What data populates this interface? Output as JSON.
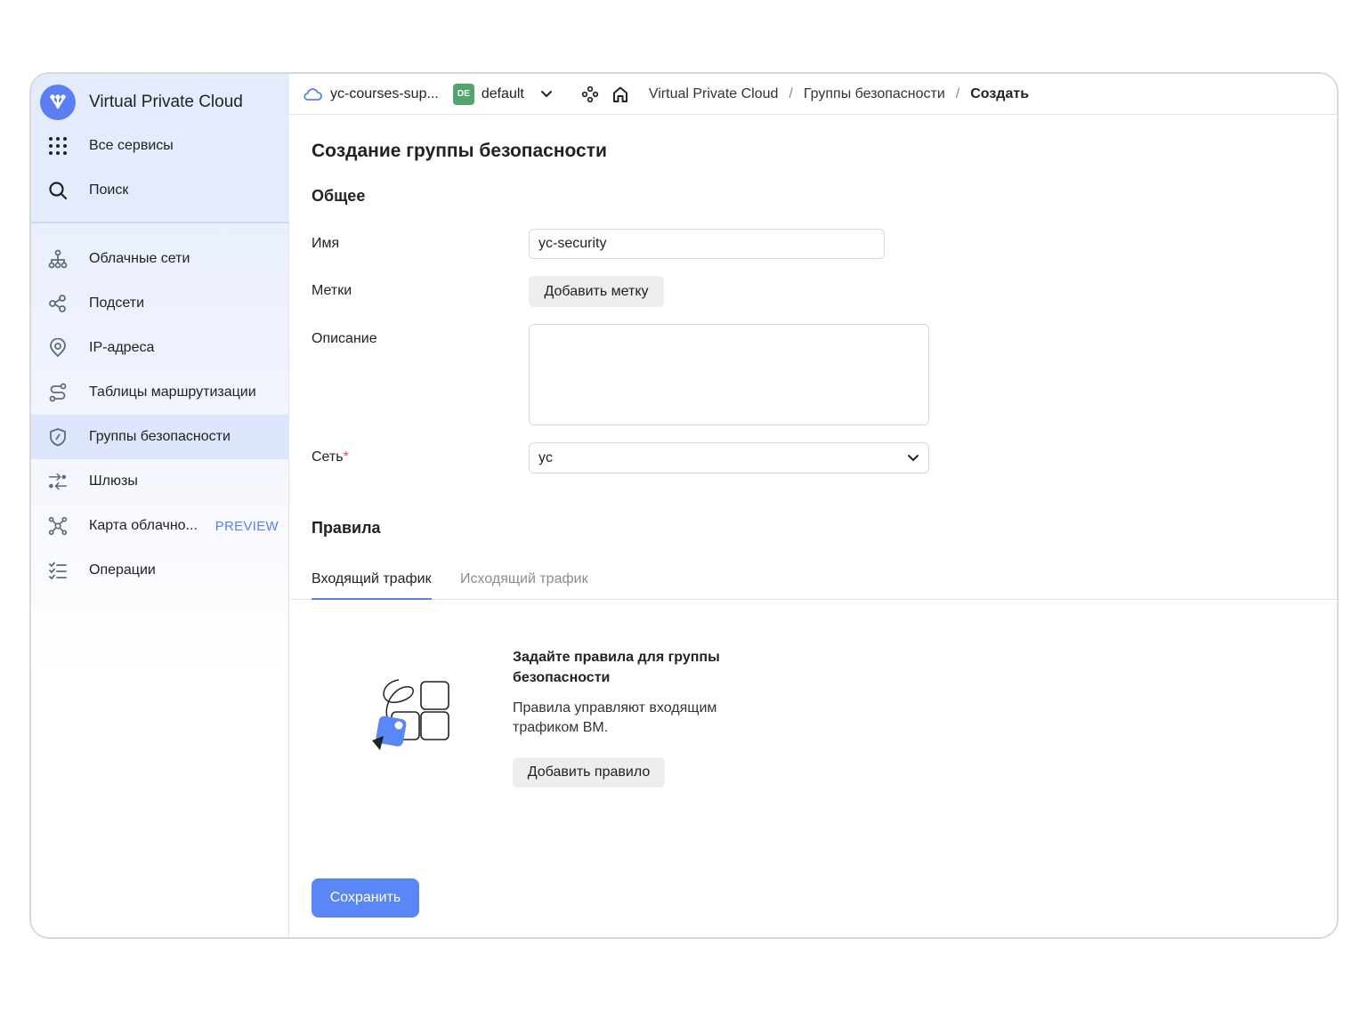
{
  "sidebar": {
    "brand_title": "Virtual Private Cloud",
    "top_items": [
      {
        "label": "Все сервисы",
        "icon": "grid-dots-icon"
      },
      {
        "label": "Поиск",
        "icon": "search-icon"
      }
    ],
    "items": [
      {
        "label": "Облачные сети",
        "icon": "network-icon"
      },
      {
        "label": "Подсети",
        "icon": "subnet-icon"
      },
      {
        "label": "IP-адреса",
        "icon": "location-pin-icon"
      },
      {
        "label": "Таблицы маршрутизации",
        "icon": "route-icon"
      },
      {
        "label": "Группы безопасности",
        "icon": "shield-icon",
        "active": true
      },
      {
        "label": "Шлюзы",
        "icon": "gateway-arrows-icon"
      },
      {
        "label": "Карта облачно...",
        "icon": "map-nodes-icon",
        "tag": "PREVIEW"
      },
      {
        "label": "Операции",
        "icon": "list-checks-icon"
      }
    ]
  },
  "header": {
    "cloud_name": "yc-courses-sup...",
    "folder_badge": "DE",
    "folder_name": "default",
    "breadcrumbs": [
      "Virtual Private Cloud",
      "Группы безопасности",
      "Создать"
    ]
  },
  "form": {
    "page_title": "Создание группы безопасности",
    "section_general": "Общее",
    "name_label": "Имя",
    "name_value": "yc-security",
    "labels_label": "Метки",
    "add_label_button": "Добавить метку",
    "description_label": "Описание",
    "description_value": "",
    "network_label": "Сеть",
    "network_required_mark": "*",
    "network_value": "yc",
    "section_rules": "Правила",
    "tabs": [
      "Входящий трафик",
      "Исходящий трафик"
    ],
    "active_tab": 0,
    "empty_title": "Задайте правила для группы безопасности",
    "empty_text": "Правила управляют входящим трафиком ВМ.",
    "add_rule_button": "Добавить правило",
    "save_button": "Сохранить"
  },
  "colors": {
    "accent": "#5b7ff3",
    "primary_button": "#5b86f5",
    "folder_badge": "#54a46e",
    "required": "#e5484d"
  }
}
